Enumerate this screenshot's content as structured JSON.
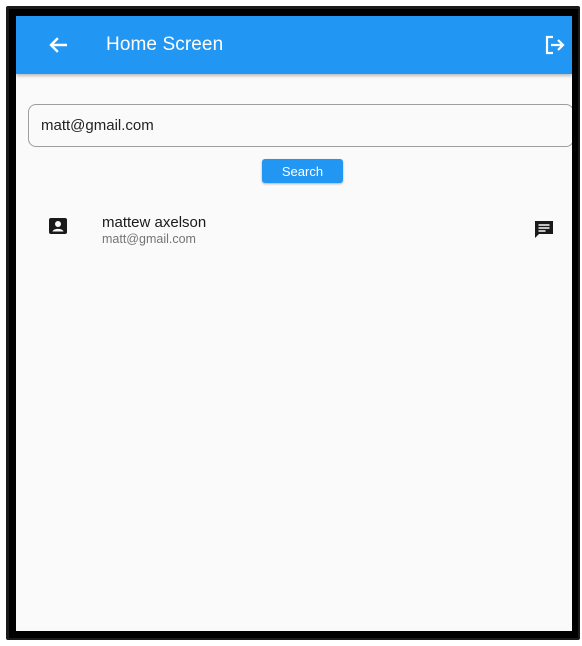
{
  "appbar": {
    "title": "Home Screen",
    "background_color": "#2196f3",
    "back_icon": "arrow-left-icon",
    "logout_icon": "logout-icon"
  },
  "search": {
    "value": "matt@gmail.com",
    "button_label": "Search"
  },
  "results": [
    {
      "name": "mattew axelson",
      "email": "matt@gmail.com",
      "leading_icon": "contact-card-icon",
      "trailing_icon": "chat-message-icon"
    }
  ]
}
